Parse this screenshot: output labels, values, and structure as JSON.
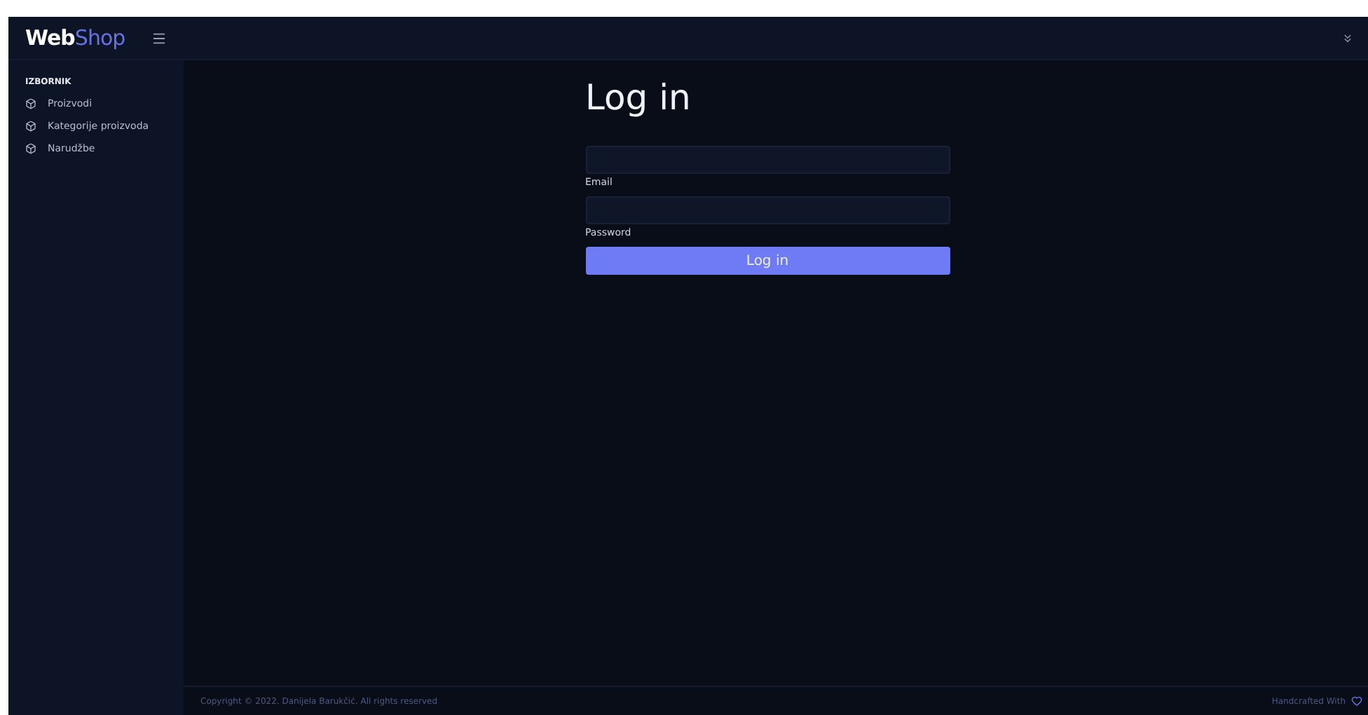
{
  "brand": {
    "bold": "Web",
    "light": "Shop"
  },
  "sidebar": {
    "heading": "IZBORNIK",
    "items": [
      {
        "label": "Proizvodi"
      },
      {
        "label": "Kategorije proizvoda"
      },
      {
        "label": "Narudžbe"
      }
    ]
  },
  "login": {
    "title": "Log in",
    "fields": [
      {
        "label": "Email"
      },
      {
        "label": "Password"
      }
    ],
    "button": "Log in"
  },
  "footer": {
    "copyright": "Copyright © 2022. Danijela Barukčić. All rights reserved",
    "credit": "Handcrafted With"
  }
}
